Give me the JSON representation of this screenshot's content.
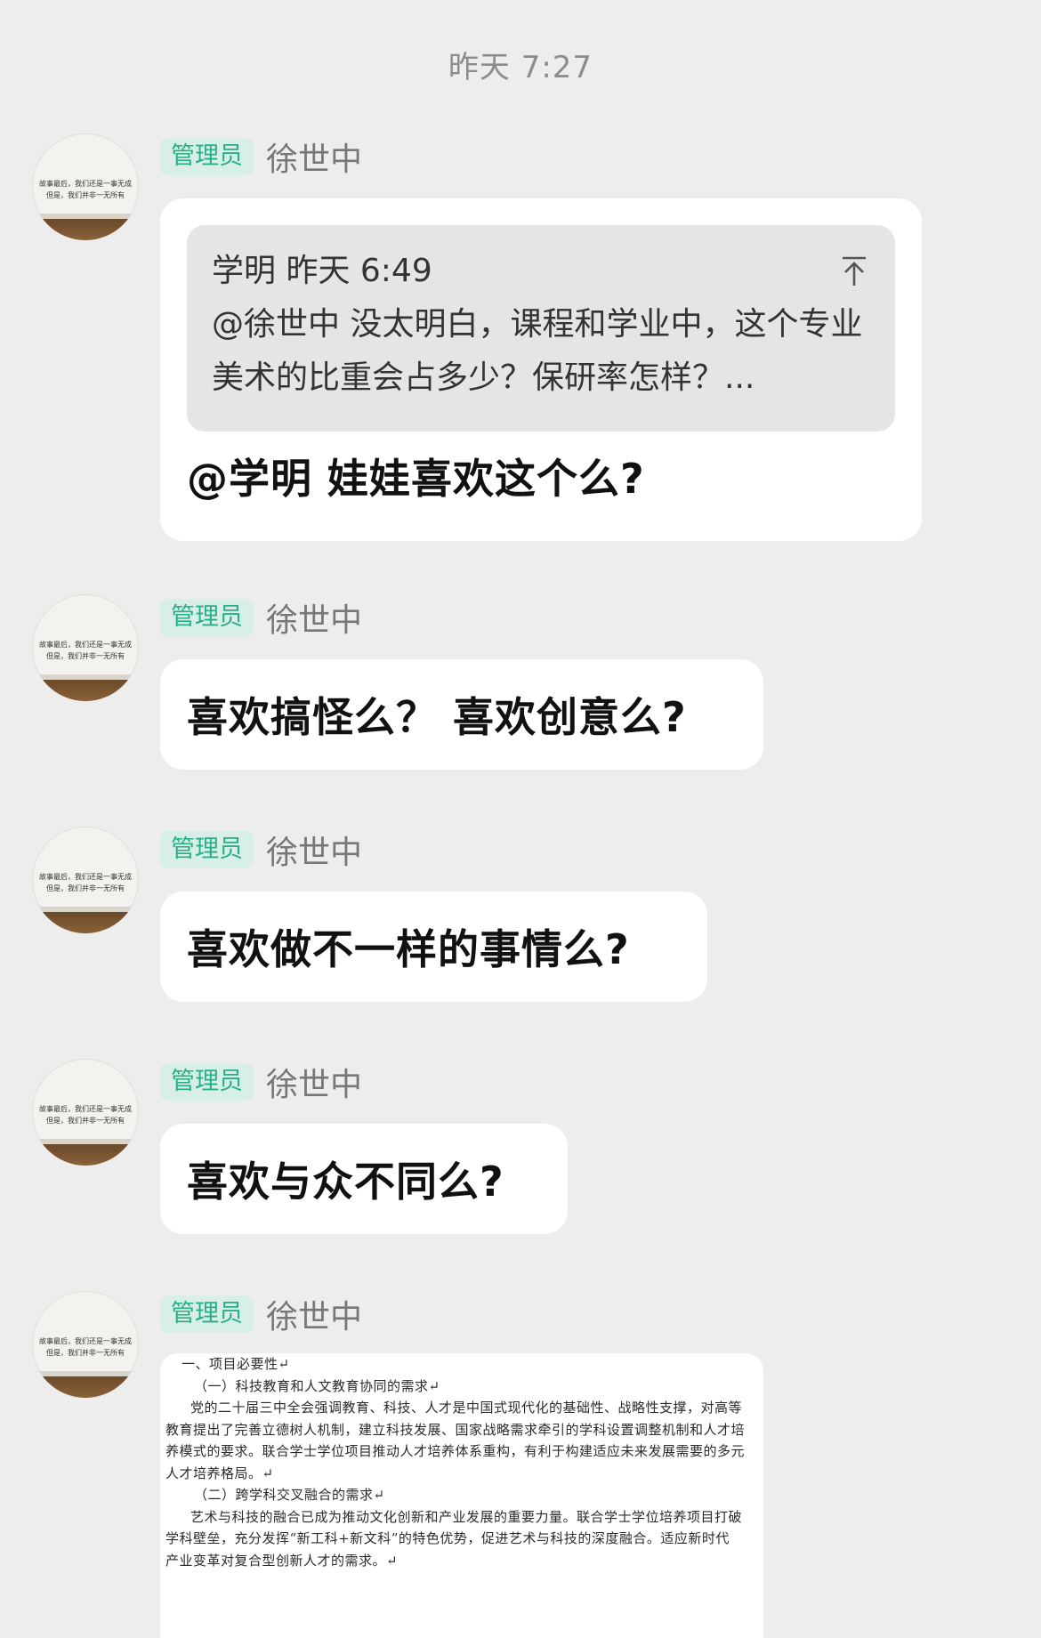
{
  "chat": {
    "timestamp": "昨天 7:27",
    "avatar_text": "故事最后，我们还是一事无成\n但是，我们并非一无所有",
    "messages": [
      {
        "badge": "管理员",
        "sender": "徐世中",
        "quote": {
          "author_time": "学明 昨天 6:49",
          "text": "@徐世中 没太明白，课程和学业中，这个专业美术的比重会占多少？保研率怎样？..."
        },
        "text": "@学明 娃娃喜欢这个么?"
      },
      {
        "badge": "管理员",
        "sender": "徐世中",
        "text": "喜欢搞怪么？  喜欢创意么?"
      },
      {
        "badge": "管理员",
        "sender": "徐世中",
        "text": "喜欢做不一样的事情么?"
      },
      {
        "badge": "管理员",
        "sender": "徐世中",
        "text": "喜欢与众不同么?"
      },
      {
        "badge": "管理员",
        "sender": "徐世中",
        "document_lines": [
          "一、项目必要性↵",
          "（一）科技教育和人文教育协同的需求↵",
          "党的二十届三中全会强调教育、科技、人才是中国式现代化的基础性、战略性支撑，对高等",
          "教育提出了完善立德树人机制，建立科技发展、国家战略需求牵引的学科设置调整机制和人才培",
          "养模式的要求。联合学士学位项目推动人才培养体系重构，有利于构建适应未来发展需要的多元",
          "人才培养格局。↵",
          "（二）跨学科交叉融合的需求↵",
          "艺术与科技的融合已成为推动文化创新和产业发展的重要力量。联合学士学位培养项目打破",
          "学科壁垒，充分发挥“新工科+新文科”的特色优势，促进艺术与科技的深度融合。适应新时代",
          "产业变革对复合型创新人才的需求。↵"
        ]
      }
    ]
  }
}
